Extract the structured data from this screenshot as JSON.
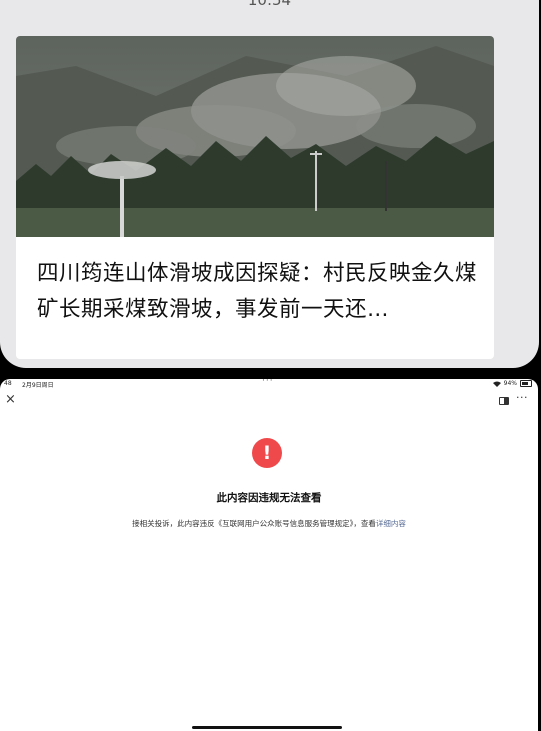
{
  "top_screen": {
    "clock": "10:54",
    "news": {
      "title": "四川筠连山体滑坡成因探疑：村民反映金久煤矿长期采煤致滑坡，事发前一天还…"
    }
  },
  "bottom_screen": {
    "status_bar": {
      "time": "48",
      "date": "2月9日周日",
      "battery": "94%"
    },
    "message": {
      "title": "此内容因违规无法查看",
      "description": "接相关投诉，此内容违反《互联网用户公众账号信息服务管理规定》，查看",
      "link": "详细内容"
    },
    "alert_symbol": "!",
    "close_symbol": "×",
    "more_symbol": "···"
  },
  "colors": {
    "alert_red": "#f0494b",
    "link_blue": "#576b95"
  }
}
